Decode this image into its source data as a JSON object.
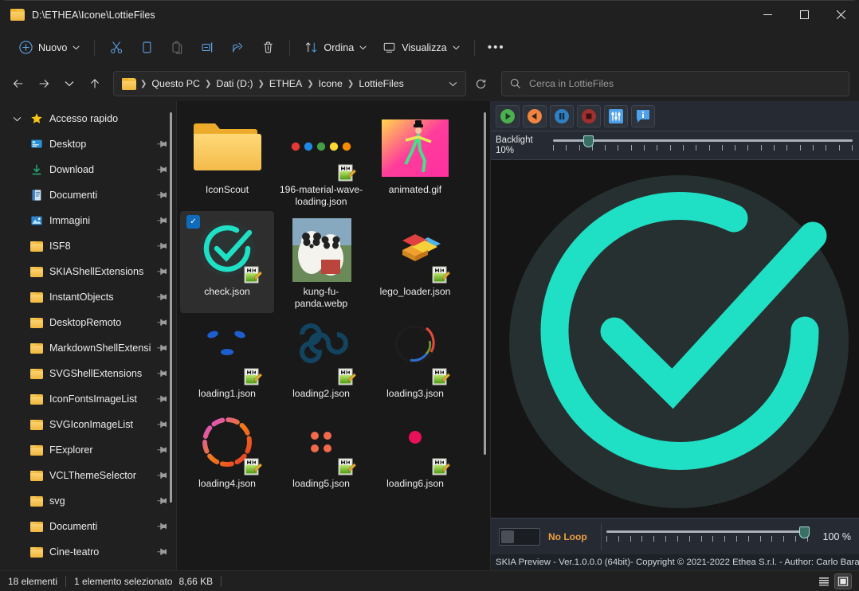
{
  "window": {
    "title": "D:\\ETHEA\\Icone\\LottieFiles",
    "minimize": "–",
    "maximize": "□",
    "close": "✕"
  },
  "toolbar": {
    "new_label": "Nuovo",
    "sort_label": "Ordina",
    "view_label": "Visualizza",
    "overflow_label": "•••",
    "items": [
      {
        "name": "cut-button",
        "icon": "scissors-icon"
      },
      {
        "name": "copy-button",
        "icon": "copy-icon"
      },
      {
        "name": "paste-button",
        "icon": "paste-icon"
      },
      {
        "name": "rename-button",
        "icon": "rename-icon"
      },
      {
        "name": "share-button",
        "icon": "share-icon"
      },
      {
        "name": "delete-button",
        "icon": "trash-icon"
      }
    ]
  },
  "address": {
    "back": "←",
    "forward": "→",
    "recent": "⌄",
    "up": "↑",
    "crumbs": [
      "Questo PC",
      "Dati (D:)",
      "ETHEA",
      "Icone",
      "LottieFiles"
    ],
    "dropdown": "⌄",
    "refresh": "↻"
  },
  "search": {
    "placeholder": "Cerca in LottieFiles",
    "value": "",
    "icon": "search-icon"
  },
  "sidebar": {
    "root": {
      "label": "Accesso rapido",
      "icon": "star-icon",
      "expander": "chevron-down-icon"
    },
    "items": [
      {
        "label": "Desktop",
        "icon": "desktop-icon",
        "pinned": true
      },
      {
        "label": "Download",
        "icon": "download-icon",
        "pinned": true
      },
      {
        "label": "Documenti",
        "icon": "documents-icon",
        "pinned": true
      },
      {
        "label": "Immagini",
        "icon": "pictures-icon",
        "pinned": true
      },
      {
        "label": "ISF8",
        "icon": "folder-icon",
        "pinned": true
      },
      {
        "label": "SKIAShellExtensions",
        "icon": "folder-icon",
        "pinned": true
      },
      {
        "label": "InstantObjects",
        "icon": "folder-icon",
        "pinned": true
      },
      {
        "label": "DesktopRemoto",
        "icon": "folder-icon",
        "pinned": true
      },
      {
        "label": "MarkdownShellExtensions",
        "icon": "folder-icon",
        "pinned": true
      },
      {
        "label": "SVGShellExtensions",
        "icon": "folder-icon",
        "pinned": true
      },
      {
        "label": "IconFontsImageList",
        "icon": "folder-icon",
        "pinned": true
      },
      {
        "label": "SVGIconImageList",
        "icon": "folder-icon",
        "pinned": true
      },
      {
        "label": "FExplorer",
        "icon": "folder-icon",
        "pinned": true
      },
      {
        "label": "VCLThemeSelector",
        "icon": "folder-icon",
        "pinned": true
      },
      {
        "label": "svg",
        "icon": "folder-icon",
        "pinned": true
      },
      {
        "label": "Documenti",
        "icon": "folder-icon",
        "pinned": true
      },
      {
        "label": "Cine-teatro",
        "icon": "folder-icon",
        "pinned": true
      }
    ]
  },
  "files": [
    {
      "name": "IconScout",
      "kind": "folder",
      "selected": false,
      "json_badge": false
    },
    {
      "name": "196-material-wave-loading.json",
      "kind": "json",
      "selected": false,
      "json_badge": true
    },
    {
      "name": "animated.gif",
      "kind": "gif",
      "selected": false,
      "json_badge": false
    },
    {
      "name": "check.json",
      "kind": "json",
      "selected": true,
      "json_badge": true
    },
    {
      "name": "kung-fu-panda.webp",
      "kind": "webp",
      "selected": false,
      "json_badge": false
    },
    {
      "name": "lego_loader.json",
      "kind": "json",
      "selected": false,
      "json_badge": true
    },
    {
      "name": "loading1.json",
      "kind": "json",
      "selected": false,
      "json_badge": true
    },
    {
      "name": "loading2.json",
      "kind": "json",
      "selected": false,
      "json_badge": true
    },
    {
      "name": "loading3.json",
      "kind": "json",
      "selected": false,
      "json_badge": true
    },
    {
      "name": "loading4.json",
      "kind": "json",
      "selected": false,
      "json_badge": true
    },
    {
      "name": "loading5.json",
      "kind": "json",
      "selected": false,
      "json_badge": true
    },
    {
      "name": "loading6.json",
      "kind": "json",
      "selected": false,
      "json_badge": true
    }
  ],
  "preview": {
    "buttons": [
      {
        "name": "play-button",
        "icon": "play-icon",
        "color": "#4caf50"
      },
      {
        "name": "reverse-button",
        "icon": "reverse-triangle-icon",
        "color": "#f08442"
      },
      {
        "name": "pause-button",
        "icon": "pause-icon",
        "color": "#2f7fc1"
      },
      {
        "name": "stop-button",
        "icon": "stop-icon",
        "color": "#a0302f"
      },
      {
        "name": "settings-button",
        "icon": "sliders-icon",
        "color": "#4ea0e8"
      },
      {
        "name": "info-button",
        "icon": "info-icon",
        "color": "#4ea0e8"
      }
    ],
    "backlight_label": "Backlight",
    "backlight_value": "10%",
    "backlight_percent": 10,
    "loop_label": "No Loop",
    "loop_on": false,
    "zoom_value": "100 %",
    "zoom_percent": 100,
    "status": "SKIA Preview - Ver.1.0.0.0 (64bit)- Copyright © 2021-2022 Ethea S.r.l. - Author: Carlo Barazzetta",
    "accent": "#1fe0c5",
    "disc_color": "#263030"
  },
  "statusbar": {
    "count": "18 elementi",
    "selection": "1 elemento selezionato",
    "size": "8,66 KB",
    "view_list": "list-view-icon",
    "view_tiles": "tiles-view-icon"
  }
}
